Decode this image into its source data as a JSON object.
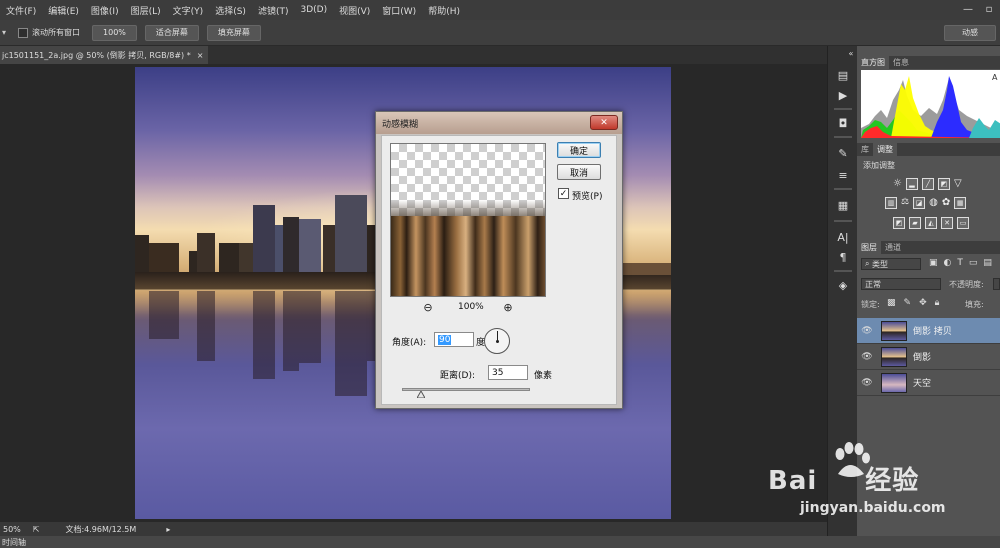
{
  "menubar": {
    "items": [
      "文件(F)",
      "编辑(E)",
      "图像(I)",
      "图层(L)",
      "文字(Y)",
      "选择(S)",
      "滤镜(T)",
      "3D(D)",
      "视图(V)",
      "窗口(W)",
      "帮助(H)"
    ]
  },
  "optionsbar": {
    "scroll_all_label": "滚动所有窗口",
    "btn_100": "100%",
    "btn_fit": "适合屏幕",
    "btn_fill": "填充屏幕",
    "workspace": "动感"
  },
  "document": {
    "tab_title": "jc1501151_2a.jpg @ 50% (倒影 拷贝, RGB/8#) *",
    "tab_close": "×"
  },
  "statusbar": {
    "zoom": "50%",
    "doc_info": "文档:4.96M/12.5M"
  },
  "timeline": {
    "label": "时间轴"
  },
  "panels": {
    "histogram_tab": "直方图",
    "info_tab": "信息",
    "library_tab": "库",
    "adjust_tab": "调整",
    "adjust_title": "添加调整",
    "layers_tab": "图层",
    "channels_tab": "通道",
    "kind_filter": "类型",
    "blend_mode": "正常",
    "opacity_label": "不透明度:",
    "lock_label": "锁定:",
    "fill_label": "填充:",
    "layers": [
      {
        "name": "倒影 拷贝",
        "selected": true
      },
      {
        "name": "倒影",
        "selected": false
      },
      {
        "name": "天空",
        "selected": false
      }
    ]
  },
  "dialog": {
    "title": "动感模糊",
    "close": "✕",
    "ok_label": "确定",
    "cancel_label": "取消",
    "preview_label": "预览(P)",
    "preview_checked": true,
    "zoom_level": "100%",
    "angle_label": "角度(A):",
    "angle_value": "90",
    "angle_unit": "度",
    "distance_label": "距离(D):",
    "distance_value": "35",
    "distance_unit": "像素"
  },
  "watermark": {
    "brand": "Bai",
    "brand2": "经验",
    "url": "jingyan.baidu.com"
  },
  "colors": {
    "selected_layer": "#6d8bb0",
    "dialog_title": "#c8b2a3",
    "close_button": "#c0392b"
  }
}
